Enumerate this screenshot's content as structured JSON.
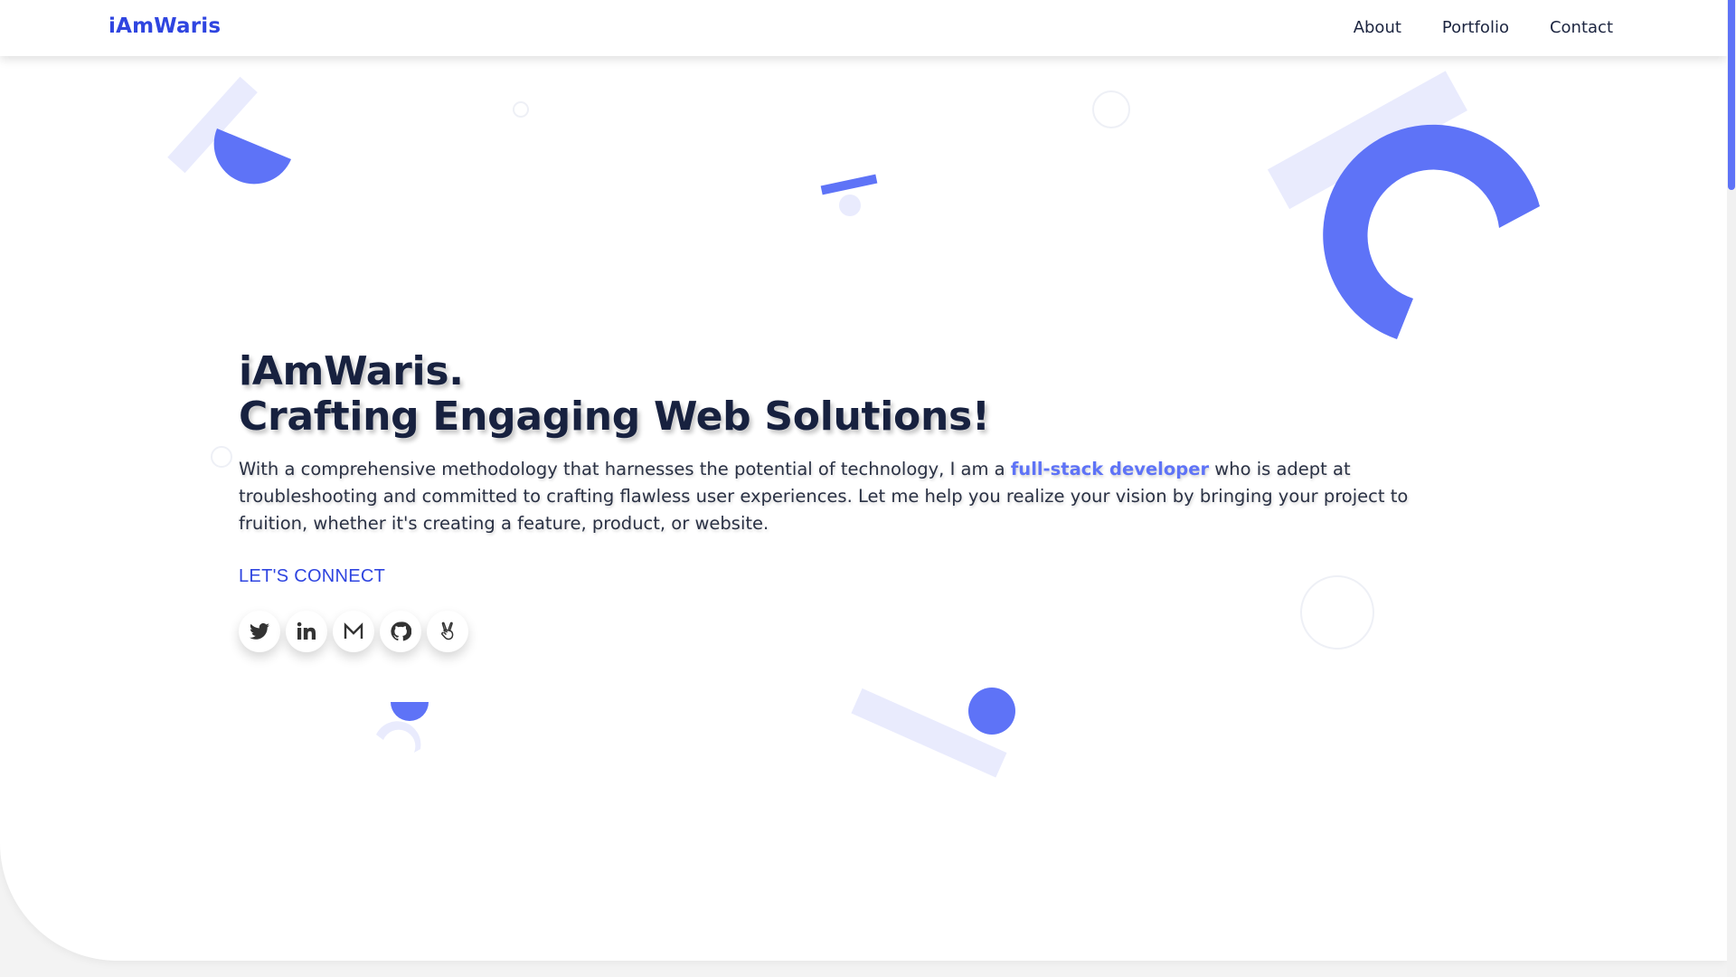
{
  "nav": {
    "brand": "iAmWaris",
    "links": [
      "About",
      "Portfolio",
      "Contact"
    ]
  },
  "hero": {
    "title_line1": "iAmWaris.",
    "title_line2": "Crafting Engaging Web Solutions!",
    "desc_before": "With a comprehensive methodology that harnesses the potential of technology, I am a ",
    "desc_highlight": "full-stack developer",
    "desc_after": " who is adept at troubleshooting and committed to crafting flawless user experiences. Let me help you realize your vision by bringing your project to fruition, whether it's creating a feature, product, or website.",
    "cta": "LET'S CONNECT"
  },
  "socials": [
    {
      "icon": "twitter-icon"
    },
    {
      "icon": "linkedin-icon"
    },
    {
      "icon": "gmail-icon"
    },
    {
      "icon": "github-icon"
    },
    {
      "icon": "angellist-icon"
    }
  ],
  "colors": {
    "accent": "#5e73f7",
    "accent_light": "#e9ebfd",
    "brand": "#2f45e0",
    "heading": "#17213f"
  }
}
